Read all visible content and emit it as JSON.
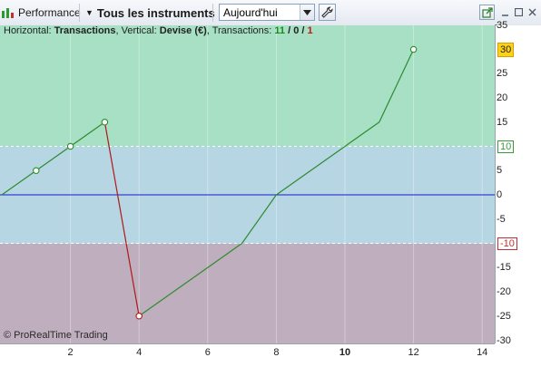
{
  "toolbar": {
    "performance_label": "Performance",
    "instruments_label": "Tous les instruments",
    "period_value": "Aujourd'hui"
  },
  "legend": {
    "horizontal_label": "Horizontal: ",
    "horizontal_value": "Transactions",
    "vertical_label": ", Vertical: ",
    "vertical_value": "Devise (€)",
    "transactions_label": ", Transactions: ",
    "count_win": "11",
    "slash1": " / ",
    "count_neutral": "0",
    "slash2": " / ",
    "count_loss": "1"
  },
  "copyright": "© ProRealTime Trading",
  "chart_data": {
    "type": "line",
    "x": [
      0,
      1,
      2,
      3,
      4,
      7,
      8,
      11,
      12
    ],
    "y": [
      0,
      5,
      10,
      15,
      -25,
      -10,
      0,
      15,
      30
    ],
    "markers_at_x": [
      1,
      2,
      3,
      4,
      12
    ],
    "xlim": [
      0,
      14.5
    ],
    "ylim": [
      -30,
      35
    ],
    "x_ticks": [
      2,
      4,
      6,
      8,
      10,
      12,
      14
    ],
    "x_tick_bold": 10,
    "y_ticks": [
      35,
      30,
      25,
      20,
      15,
      10,
      5,
      0,
      -5,
      -10,
      -15,
      -20,
      -25,
      -30
    ],
    "upper_threshold": 10,
    "lower_threshold": -10,
    "last_value": 30,
    "colors": {
      "gain_line": "#2e8b2e",
      "loss_line": "#b01818",
      "zero_line": "#1a1ad0",
      "zone_top": "#a7e0c4",
      "zone_mid": "#b6d6e4",
      "zone_bottom": "#bfaebd",
      "last_box": "#ffd21a"
    }
  }
}
